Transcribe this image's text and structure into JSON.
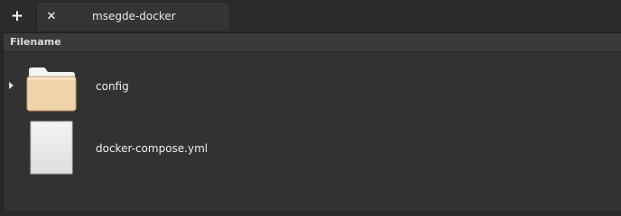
{
  "tabbar": {
    "new_tab_icon": "plus-icon",
    "tabs": [
      {
        "label": "msegde-docker",
        "close_icon": "close-icon"
      }
    ]
  },
  "file_browser": {
    "column_header": "Filename",
    "items": [
      {
        "name": "config",
        "type": "folder",
        "expandable": true,
        "icon": "folder-icon"
      },
      {
        "name": "docker-compose.yml",
        "type": "file",
        "expandable": false,
        "icon": "file-icon"
      }
    ]
  },
  "colors": {
    "background": "#323232",
    "tabbar": "#2b2b2b",
    "folder": "#f0d2a6",
    "file": "#ececec"
  }
}
